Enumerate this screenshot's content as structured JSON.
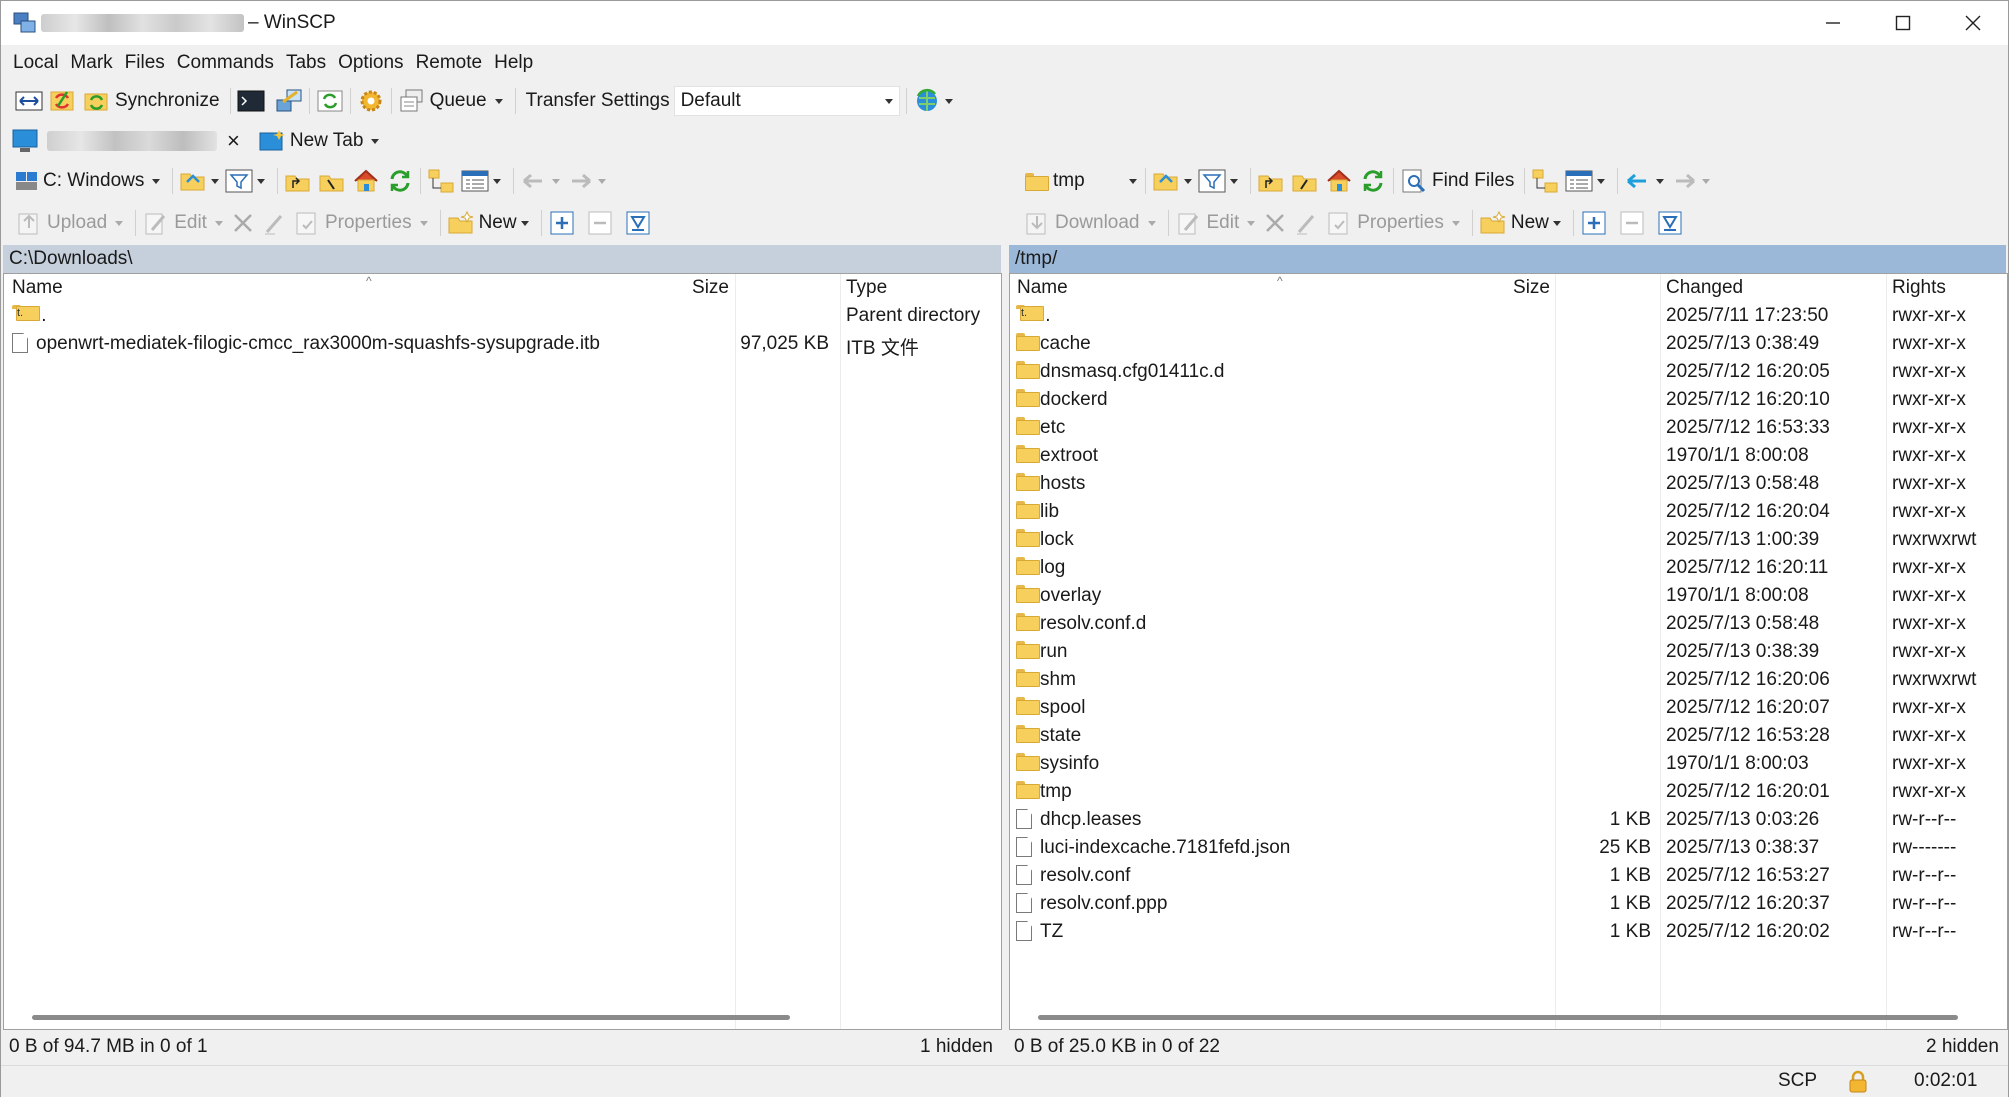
{
  "window": {
    "title": "– WinSCP"
  },
  "menu": [
    "Local",
    "Mark",
    "Files",
    "Commands",
    "Tabs",
    "Options",
    "Remote",
    "Help"
  ],
  "toolbar": {
    "synchronize": "Synchronize",
    "queue": "Queue",
    "transfer_settings": "Transfer Settings",
    "transfer_value": "Default"
  },
  "tabs": {
    "new_tab": "New Tab",
    "close": "×"
  },
  "left": {
    "drive": "C: Windows",
    "actions": {
      "upload": "Upload",
      "edit": "Edit",
      "properties": "Properties",
      "new": "New"
    },
    "path": "C:\\Downloads\\",
    "columns": {
      "name": "Name",
      "size": "Size",
      "type": "Type"
    },
    "rows": [
      {
        "name": "..",
        "size": "",
        "type": "Parent directory",
        "kind": "up"
      },
      {
        "name": "openwrt-mediatek-filogic-cmcc_rax3000m-squashfs-sysupgrade.itb",
        "size": "97,025 KB",
        "type": "ITB 文件",
        "kind": "file"
      }
    ],
    "status": "0 B of 94.7 MB in 0 of 1",
    "hidden": "1 hidden"
  },
  "right": {
    "dir": "tmp",
    "find_files": "Find Files",
    "actions": {
      "download": "Download",
      "edit": "Edit",
      "properties": "Properties",
      "new": "New"
    },
    "path": "/tmp/",
    "columns": {
      "name": "Name",
      "size": "Size",
      "changed": "Changed",
      "rights": "Rights"
    },
    "rows": [
      {
        "name": "..",
        "size": "",
        "changed": "2025/7/11 17:23:50",
        "rights": "rwxr-xr-x",
        "kind": "up"
      },
      {
        "name": "cache",
        "size": "",
        "changed": "2025/7/13 0:38:49",
        "rights": "rwxr-xr-x",
        "kind": "folder"
      },
      {
        "name": "dnsmasq.cfg01411c.d",
        "size": "",
        "changed": "2025/7/12 16:20:05",
        "rights": "rwxr-xr-x",
        "kind": "folder"
      },
      {
        "name": "dockerd",
        "size": "",
        "changed": "2025/7/12 16:20:10",
        "rights": "rwxr-xr-x",
        "kind": "folder"
      },
      {
        "name": "etc",
        "size": "",
        "changed": "2025/7/12 16:53:33",
        "rights": "rwxr-xr-x",
        "kind": "folder"
      },
      {
        "name": "extroot",
        "size": "",
        "changed": "1970/1/1 8:00:08",
        "rights": "rwxr-xr-x",
        "kind": "folder"
      },
      {
        "name": "hosts",
        "size": "",
        "changed": "2025/7/13 0:58:48",
        "rights": "rwxr-xr-x",
        "kind": "folder"
      },
      {
        "name": "lib",
        "size": "",
        "changed": "2025/7/12 16:20:04",
        "rights": "rwxr-xr-x",
        "kind": "folder"
      },
      {
        "name": "lock",
        "size": "",
        "changed": "2025/7/13 1:00:39",
        "rights": "rwxrwxrwt",
        "kind": "folder"
      },
      {
        "name": "log",
        "size": "",
        "changed": "2025/7/12 16:20:11",
        "rights": "rwxr-xr-x",
        "kind": "folder"
      },
      {
        "name": "overlay",
        "size": "",
        "changed": "1970/1/1 8:00:08",
        "rights": "rwxr-xr-x",
        "kind": "folder"
      },
      {
        "name": "resolv.conf.d",
        "size": "",
        "changed": "2025/7/13 0:58:48",
        "rights": "rwxr-xr-x",
        "kind": "folder"
      },
      {
        "name": "run",
        "size": "",
        "changed": "2025/7/13 0:38:39",
        "rights": "rwxr-xr-x",
        "kind": "folder"
      },
      {
        "name": "shm",
        "size": "",
        "changed": "2025/7/12 16:20:06",
        "rights": "rwxrwxrwt",
        "kind": "folder"
      },
      {
        "name": "spool",
        "size": "",
        "changed": "2025/7/12 16:20:07",
        "rights": "rwxr-xr-x",
        "kind": "folder"
      },
      {
        "name": "state",
        "size": "",
        "changed": "2025/7/12 16:53:28",
        "rights": "rwxr-xr-x",
        "kind": "folder"
      },
      {
        "name": "sysinfo",
        "size": "",
        "changed": "1970/1/1 8:00:03",
        "rights": "rwxr-xr-x",
        "kind": "folder"
      },
      {
        "name": "tmp",
        "size": "",
        "changed": "2025/7/12 16:20:01",
        "rights": "rwxr-xr-x",
        "kind": "folder"
      },
      {
        "name": "dhcp.leases",
        "size": "1 KB",
        "changed": "2025/7/13 0:03:26",
        "rights": "rw-r--r--",
        "kind": "file"
      },
      {
        "name": "luci-indexcache.7181fefd.json",
        "size": "25 KB",
        "changed": "2025/7/13 0:38:37",
        "rights": "rw-------",
        "kind": "json"
      },
      {
        "name": "resolv.conf",
        "size": "1 KB",
        "changed": "2025/7/12 16:53:27",
        "rights": "rw-r--r--",
        "kind": "file"
      },
      {
        "name": "resolv.conf.ppp",
        "size": "1 KB",
        "changed": "2025/7/12 16:20:37",
        "rights": "rw-r--r--",
        "kind": "file"
      },
      {
        "name": "TZ",
        "size": "1 KB",
        "changed": "2025/7/12 16:20:02",
        "rights": "rw-r--r--",
        "kind": "file"
      }
    ],
    "status": "0 B of 25.0 KB in 0 of 22",
    "hidden": "2 hidden"
  },
  "bottom": {
    "protocol": "SCP",
    "timer": "0:02:01"
  }
}
